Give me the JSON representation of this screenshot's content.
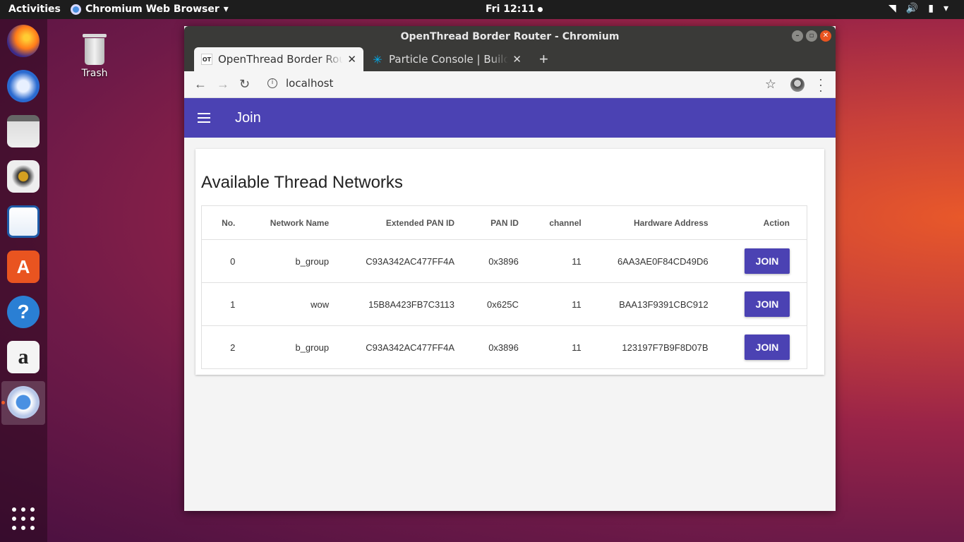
{
  "topbar": {
    "activities": "Activities",
    "app_name": "Chromium Web Browser",
    "app_menu_arrow": "▾",
    "clock": "Fri 12:11",
    "tray": {
      "network": "◥",
      "volume": "🔊",
      "battery": "▮",
      "menu_arrow": "▾"
    }
  },
  "desktop": {
    "trash_label": "Trash"
  },
  "window": {
    "title": "OpenThread Border Router - Chromium",
    "tabs": [
      {
        "label": "OpenThread Border Router",
        "favicon": "OT"
      },
      {
        "label": "Particle Console | Build your",
        "favicon": "✳"
      }
    ],
    "new_tab": "+",
    "url": "localhost"
  },
  "page": {
    "appbar_title": "Join",
    "card_title": "Available Thread Networks",
    "columns": [
      "No.",
      "Network Name",
      "Extended PAN ID",
      "PAN ID",
      "channel",
      "Hardware Address",
      "Action"
    ],
    "rows": [
      {
        "no": "0",
        "name": "b_group",
        "ext_pan_id": "C93A342AC477FF4A",
        "pan_id": "0x3896",
        "channel": "11",
        "hw": "6AA3AE0F84CD49D6",
        "action": "JOIN"
      },
      {
        "no": "1",
        "name": "wow",
        "ext_pan_id": "15B8A423FB7C3113",
        "pan_id": "0x625C",
        "channel": "11",
        "hw": "BAA13F9391CBC912",
        "action": "JOIN"
      },
      {
        "no": "2",
        "name": "b_group",
        "ext_pan_id": "C93A342AC477FF4A",
        "pan_id": "0x3896",
        "channel": "11",
        "hw": "123197F7B9F8D07B",
        "action": "JOIN"
      }
    ]
  },
  "colors": {
    "appbar": "#4b42b3",
    "accent": "#e95420"
  }
}
